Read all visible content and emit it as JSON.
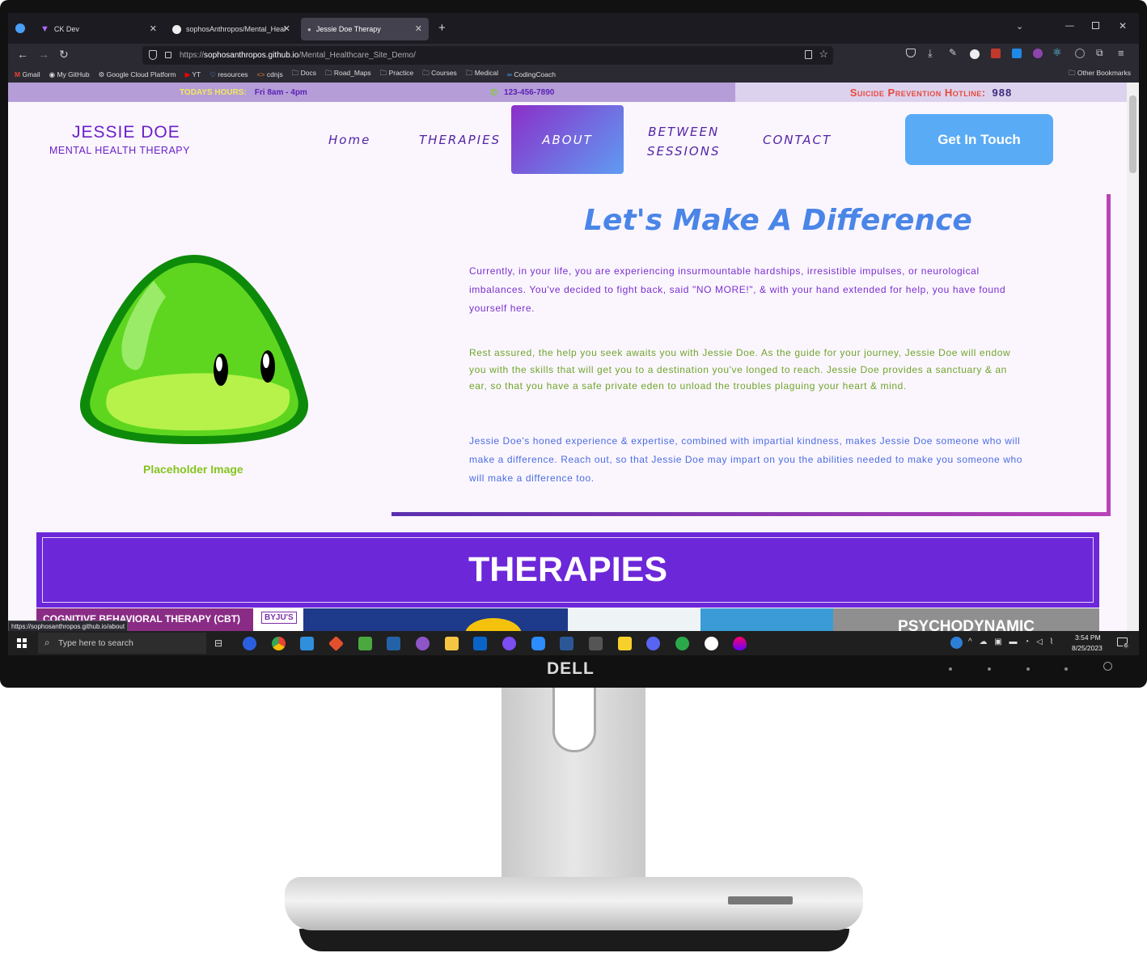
{
  "browser": {
    "tabs": [
      {
        "label": "CK Dev"
      },
      {
        "label": "sophosAnthropos/Mental_Heal"
      },
      {
        "label": "Jessie Doe Therapy"
      }
    ],
    "url_prefix": "https://",
    "url_domain": "sophosanthropos.github.io",
    "url_path": "/Mental_Healthcare_Site_Demo/",
    "bookmarks": [
      "Gmail",
      "My GitHub",
      "Google Cloud Platform",
      "YT",
      "resources",
      "cdnjs",
      "Docs",
      "Road_Maps",
      "Practice",
      "Courses",
      "Medical",
      "CodingCoach"
    ],
    "other_bookmarks": "Other Bookmarks",
    "status_url": "https://sophosanthropos.github.io/about"
  },
  "site": {
    "hours_label": "TODAYS HOURS:",
    "hours_value": "Fri 8am - 4pm",
    "phone": "123-456-7890",
    "hotline_label": "Suicide Prevention Hotline:",
    "hotline_number": "988",
    "brand_name": "JESSIE DOE",
    "brand_sub": "MENTAL HEALTH THERAPY",
    "nav": {
      "home": "Home",
      "therapies": "THERAPIES",
      "about": "ABOUT",
      "between1": "BETWEEN",
      "between2": "SESSIONS",
      "contact": "CONTACT"
    },
    "cta": "Get In Touch",
    "headline": "Let's Make A Difference",
    "p1": "Currently, in your life, you are experiencing insurmountable hardships, irresistible impulses, or neurological imbalances. You've decided to fight back, said \"NO MORE!\", & with your hand extended for help, you have found yourself here.",
    "p2": "Rest assured, the help you seek awaits you with Jessie Doe. As the guide for your journey, Jessie Doe will endow you with the skills that will get you to a destination you've longed to reach. Jessie Doe provides a sanctuary & an ear, so that you have a safe private eden to unload the troubles plaguing your heart & mind.",
    "p3": "Jessie Doe's honed experience & expertise, combined with impartial kindness, makes Jessie Doe someone who will make a difference. Reach out, so that Jessie Doe may impart on you the abilities needed to make you someone who will make a difference too.",
    "image_caption": "Placeholder Image",
    "therapies_title": "THERAPIES",
    "card1_title": "COGNITIVE BEHAVIORAL THERAPY (CBT)",
    "card1_badge": "BYJU'S",
    "card4_title": "PSYCHODYNAMIC"
  },
  "taskbar": {
    "search_placeholder": "Type here to search",
    "time": "3:54 PM",
    "date": "8/25/2023",
    "notif_count": "6"
  },
  "monitor": {
    "brand": "DELL"
  },
  "colors": {
    "purple": "#6a20c9",
    "blue": "#4a85e8",
    "green": "#6fa52b",
    "accent": "#6c27d9"
  }
}
